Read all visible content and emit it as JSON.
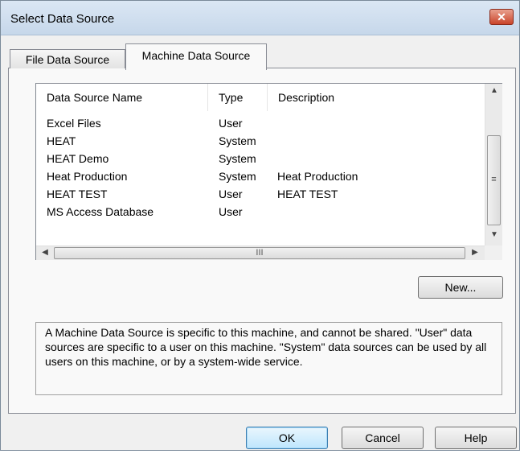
{
  "window": {
    "title": "Select Data Source",
    "close_glyph": "✕"
  },
  "tabs": [
    {
      "label": "File Data Source",
      "selected": false
    },
    {
      "label": "Machine Data Source",
      "selected": true
    }
  ],
  "list": {
    "columns": [
      "Data Source Name",
      "Type",
      "Description"
    ],
    "rows": [
      {
        "name": "Excel Files",
        "type": "User",
        "description": ""
      },
      {
        "name": "HEAT",
        "type": "System",
        "description": ""
      },
      {
        "name": "HEAT Demo",
        "type": "System",
        "description": ""
      },
      {
        "name": "Heat Production",
        "type": "System",
        "description": "Heat Production"
      },
      {
        "name": "HEAT TEST",
        "type": "User",
        "description": "HEAT TEST"
      },
      {
        "name": "MS Access Database",
        "type": "User",
        "description": ""
      }
    ],
    "scroll_up_glyph": "▲",
    "scroll_down_glyph": "▼",
    "scroll_left_glyph": "◀",
    "scroll_right_glyph": "▶",
    "v_grip": "≡",
    "h_grip": "III"
  },
  "buttons": {
    "new": "New...",
    "ok": "OK",
    "cancel": "Cancel",
    "help": "Help"
  },
  "info": {
    "text": "A Machine Data Source is specific to this machine, and cannot be shared. \"User\" data sources are specific to a user on this machine.  \"System\" data sources can be used by all users on this machine, or by a system-wide service."
  },
  "colors": {
    "titlebar": "#c6d7ea",
    "close_button": "#c9442a",
    "default_button_border": "#3c7fb1"
  }
}
